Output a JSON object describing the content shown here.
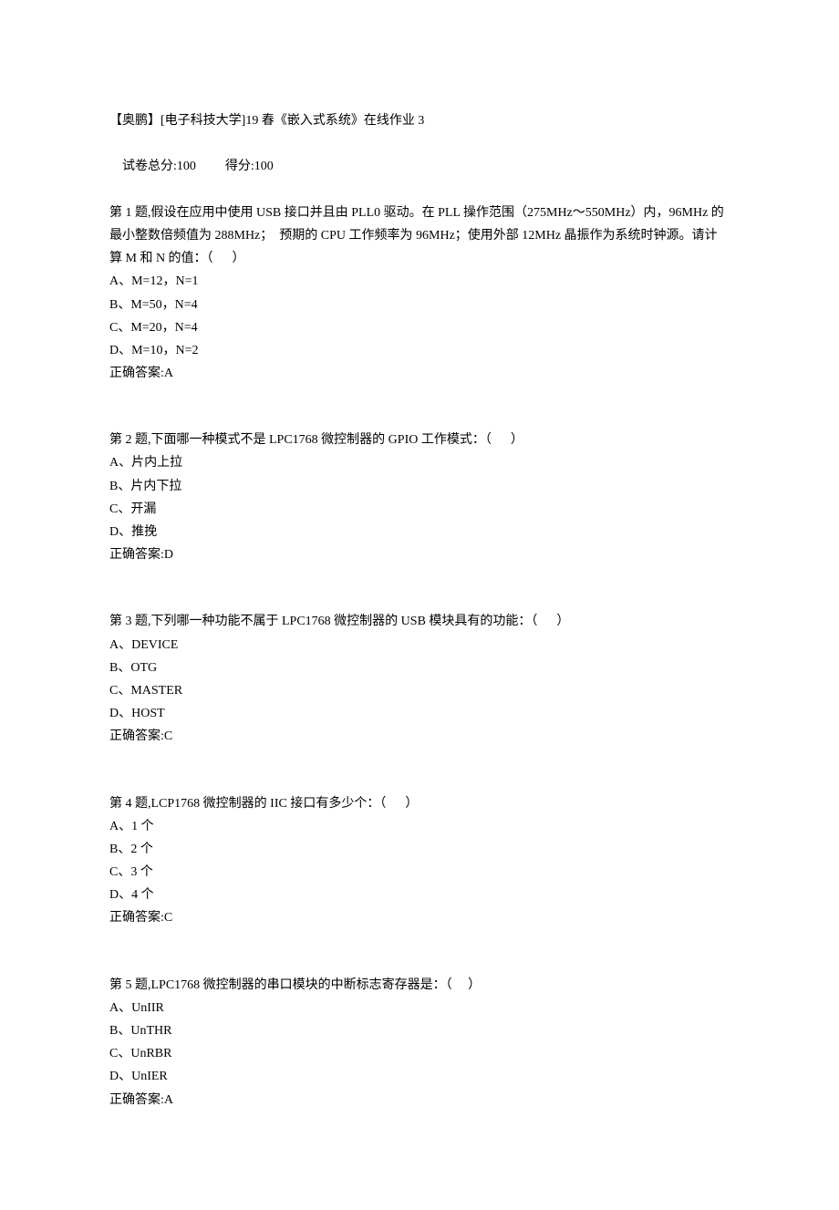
{
  "header": {
    "title": "【奥鹏】[电子科技大学]19 春《嵌入式系统》在线作业 3",
    "score_prefix": "试卷总分:",
    "score_total": "100",
    "score_gain_prefix": "得分:",
    "score_gain": "100"
  },
  "questions": [
    {
      "stem_lines": [
        "第 1 题,假设在应用中使用 USB 接口并且由 PLL0 驱动。在 PLL 操作范围（275MHz～550MHz）内，96MHz 的最小整数倍频值为 288MHz；  预期的 CPU 工作频率为 96MHz；使用外部 12MHz 晶振作为系统时钟源。请计算 M 和 N 的值：（      ）"
      ],
      "options": [
        "A、M=12，N=1",
        "B、M=50，N=4",
        "C、M=20，N=4",
        "D、M=10，N=2"
      ],
      "answer": "正确答案:A"
    },
    {
      "stem_lines": [
        "第 2 题,下面哪一种模式不是 LPC1768 微控制器的 GPIO 工作模式：（      ）"
      ],
      "options": [
        "A、片内上拉",
        "B、片内下拉",
        "C、开漏",
        "D、推挽"
      ],
      "answer": "正确答案:D"
    },
    {
      "stem_lines": [
        "第 3 题,下列哪一种功能不属于 LPC1768 微控制器的 USB 模块具有的功能：（      ）"
      ],
      "options": [
        "A、DEVICE",
        "B、OTG",
        "C、MASTER",
        "D、HOST"
      ],
      "answer": "正确答案:C"
    },
    {
      "stem_lines": [
        "第 4 题,LCP1768 微控制器的 IIC 接口有多少个：（      ）"
      ],
      "options": [
        "A、1 个",
        "B、2 个",
        "C、3 个",
        "D、4 个"
      ],
      "answer": "正确答案:C"
    },
    {
      "stem_lines": [
        "第 5 题,LPC1768 微控制器的串口模块的中断标志寄存器是：（     ）"
      ],
      "options": [
        "A、UnIIR",
        "B、UnTHR",
        "C、UnRBR",
        "D、UnIER"
      ],
      "answer": "正确答案:A"
    }
  ]
}
